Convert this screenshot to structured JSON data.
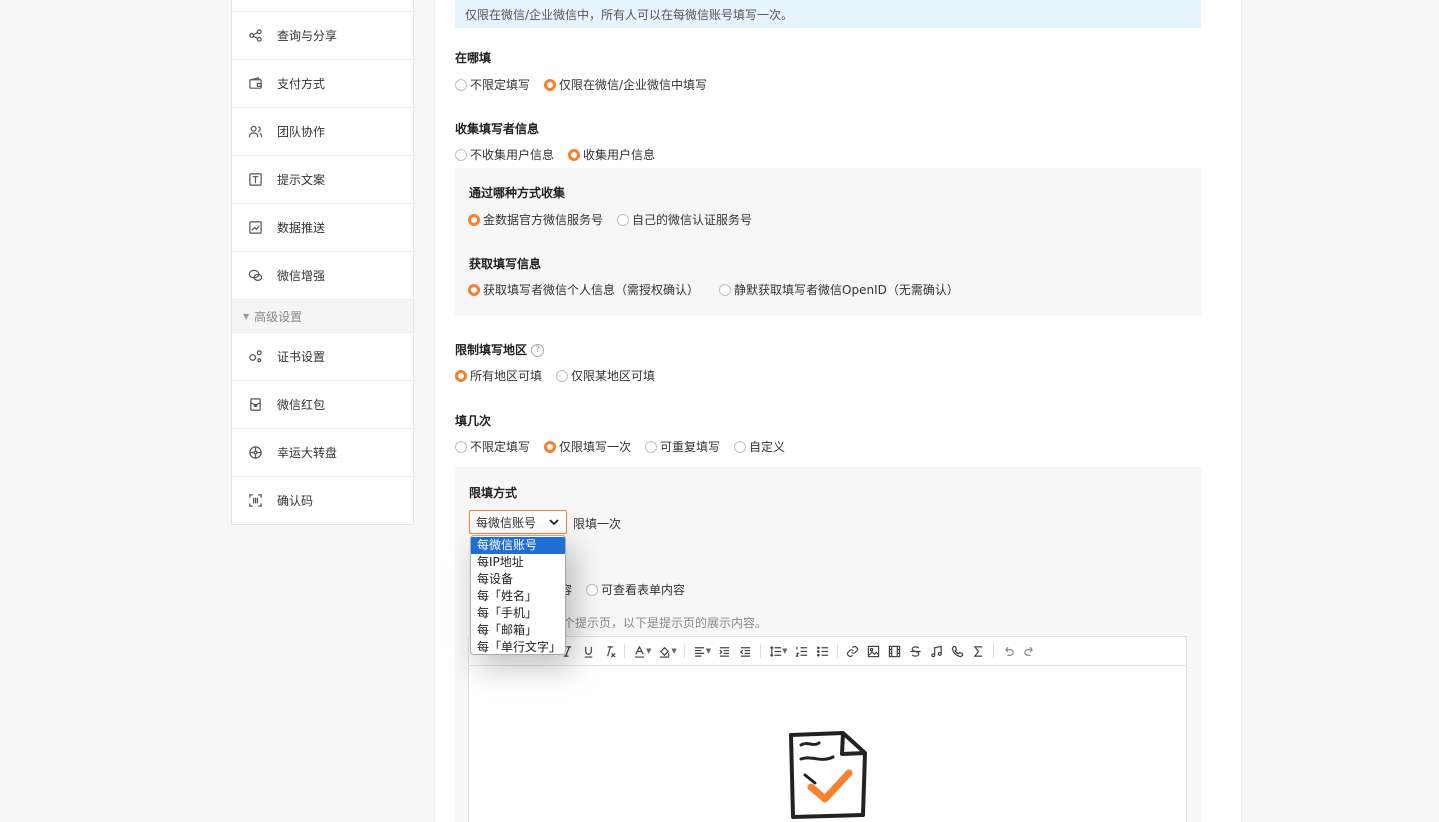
{
  "sidebar": {
    "items_top": [
      {
        "label": "查询与分享",
        "icon": "share-icon"
      },
      {
        "label": "支付方式",
        "icon": "wallet-icon"
      },
      {
        "label": "团队协作",
        "icon": "team-icon"
      },
      {
        "label": "提示文案",
        "icon": "text-icon"
      },
      {
        "label": "数据推送",
        "icon": "chart-icon"
      },
      {
        "label": "微信增强",
        "icon": "wechat-icon"
      }
    ],
    "section_label": "高级设置",
    "items_bottom": [
      {
        "label": "证书设置",
        "icon": "certificate-icon"
      },
      {
        "label": "微信红包",
        "icon": "red-packet-icon"
      },
      {
        "label": "幸运大转盘",
        "icon": "wheel-icon"
      },
      {
        "label": "确认码",
        "icon": "scan-code-icon"
      }
    ]
  },
  "notice": "仅限在微信/企业微信中，所有人可以在每微信账号填写一次。",
  "where": {
    "label": "在哪填",
    "options": [
      "不限定填写",
      "仅限在微信/企业微信中填写"
    ],
    "selected": 1
  },
  "collect": {
    "label": "收集填写者信息",
    "options": [
      "不收集用户信息",
      "收集用户信息"
    ],
    "selected": 1,
    "method": {
      "label": "通过哪种方式收集",
      "options": [
        "金数据官方微信服务号",
        "自己的微信认证服务号"
      ],
      "selected": 0
    },
    "fetch": {
      "label": "获取填写信息",
      "options": [
        "获取填写者微信个人信息（需授权确认）",
        "静默获取填写者微信OpenID（无需确认）"
      ],
      "selected": 0
    }
  },
  "region": {
    "label": "限制填写地区",
    "help": "?",
    "options": [
      "所有地区可填",
      "仅限某地区可填"
    ],
    "selected": 0
  },
  "times": {
    "label": "填几次",
    "options": [
      "不限定填写",
      "仅限填写一次",
      "可重复填写",
      "自定义"
    ],
    "selected": 1,
    "limit": {
      "label": "限填方式",
      "select_value": "每微信账号",
      "after_text": "限填一次",
      "dropdown_options": [
        "每微信账号",
        "每IP地址",
        "每设备",
        "每「姓名」",
        "每「手机」",
        "每「邮箱」",
        "每「单行文字」"
      ],
      "dropdown_selected": 0
    },
    "view": {
      "partial_option": "容",
      "option2": "可查看表单内容"
    },
    "hint_partial": "个提示页，以下是提示页的展示内容。"
  },
  "editor": {
    "toolbar_icons": [
      "italic-icon",
      "underline-icon",
      "clear-format-icon",
      "font-color-icon",
      "bg-color-icon",
      "align-icon",
      "indent-icon",
      "outdent-icon",
      "line-height-icon",
      "ordered-list-icon",
      "bullet-list-icon",
      "link-icon",
      "image-icon",
      "video-icon",
      "strikethrough-icon",
      "music-icon",
      "phone-icon",
      "formula-icon",
      "undo-icon",
      "redo-icon"
    ]
  },
  "colors": {
    "accent": "#f7812c",
    "notice_bg": "#e6f4fe",
    "dropdown_highlight": "#1f6ed4"
  }
}
